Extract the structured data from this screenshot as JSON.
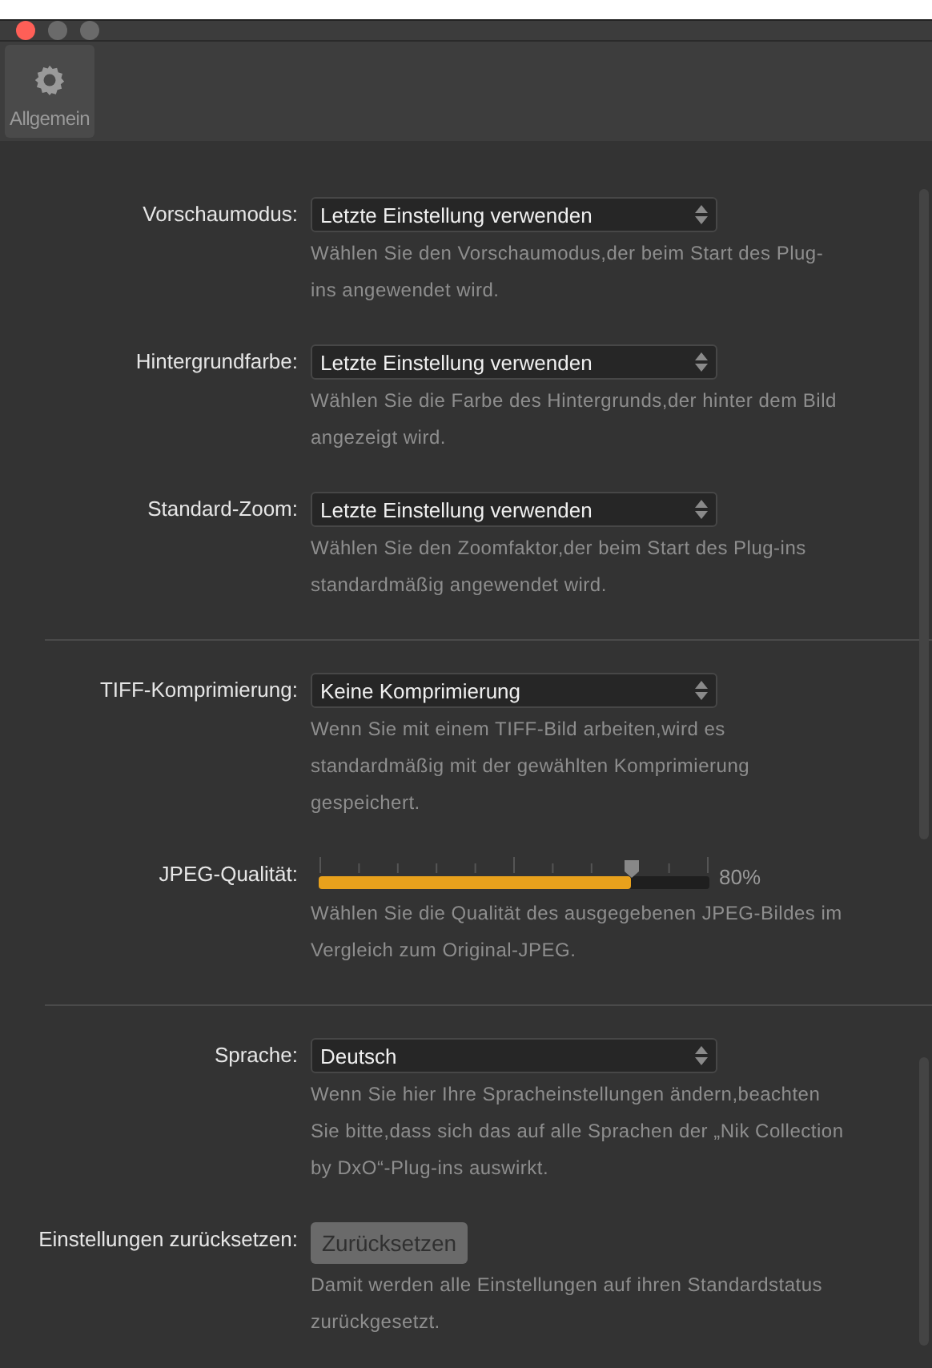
{
  "toolbar": {
    "items": [
      {
        "label": "Allgemein",
        "selected": true
      }
    ]
  },
  "sections": [
    {
      "rows": [
        {
          "kind": "select",
          "label": "Vorschaumodus:",
          "value": "Letzte Einstellung verwenden",
          "description": "Wählen Sie den Vorschaumodus,der beim Start des Plug-ins angewendet wird."
        },
        {
          "kind": "select",
          "label": "Hintergrundfarbe:",
          "value": "Letzte Einstellung verwenden",
          "description": "Wählen Sie die Farbe des Hintergrunds,der hinter dem Bild angezeigt wird."
        },
        {
          "kind": "select",
          "label": "Standard-Zoom:",
          "value": "Letzte Einstellung verwenden",
          "description": "Wählen Sie den Zoomfaktor,der beim Start des Plug-ins standardmäßig angewendet wird."
        }
      ]
    },
    {
      "rows": [
        {
          "kind": "select",
          "label": "TIFF-Komprimierung:",
          "value": "Keine Komprimierung",
          "description": "Wenn Sie mit einem TIFF-Bild arbeiten,wird es standardmäßig mit der gewählten Komprimierung gespeichert."
        },
        {
          "kind": "slider",
          "label": "JPEG-Qualität:",
          "level": 0.8,
          "reading": "80%",
          "description": "Wählen Sie die Qualität des ausgegebenen JPEG-Bildes im Vergleich zum Original-JPEG."
        }
      ]
    },
    {
      "rows": [
        {
          "kind": "select",
          "label": "Sprache:",
          "value": "Deutsch",
          "description": "Wenn Sie hier Ihre Spracheinstellungen ändern,beachten Sie bitte,dass sich das auf alle Sprachen der „Nik Collection by DxO“-Plug-ins auswirkt."
        },
        {
          "kind": "button",
          "label": "Einstellungen zurücksetzen:",
          "value": "Zurücksetzen",
          "description": "Damit werden alle Einstellungen auf ihren Standardstatus zurückgesetzt."
        }
      ]
    }
  ]
}
